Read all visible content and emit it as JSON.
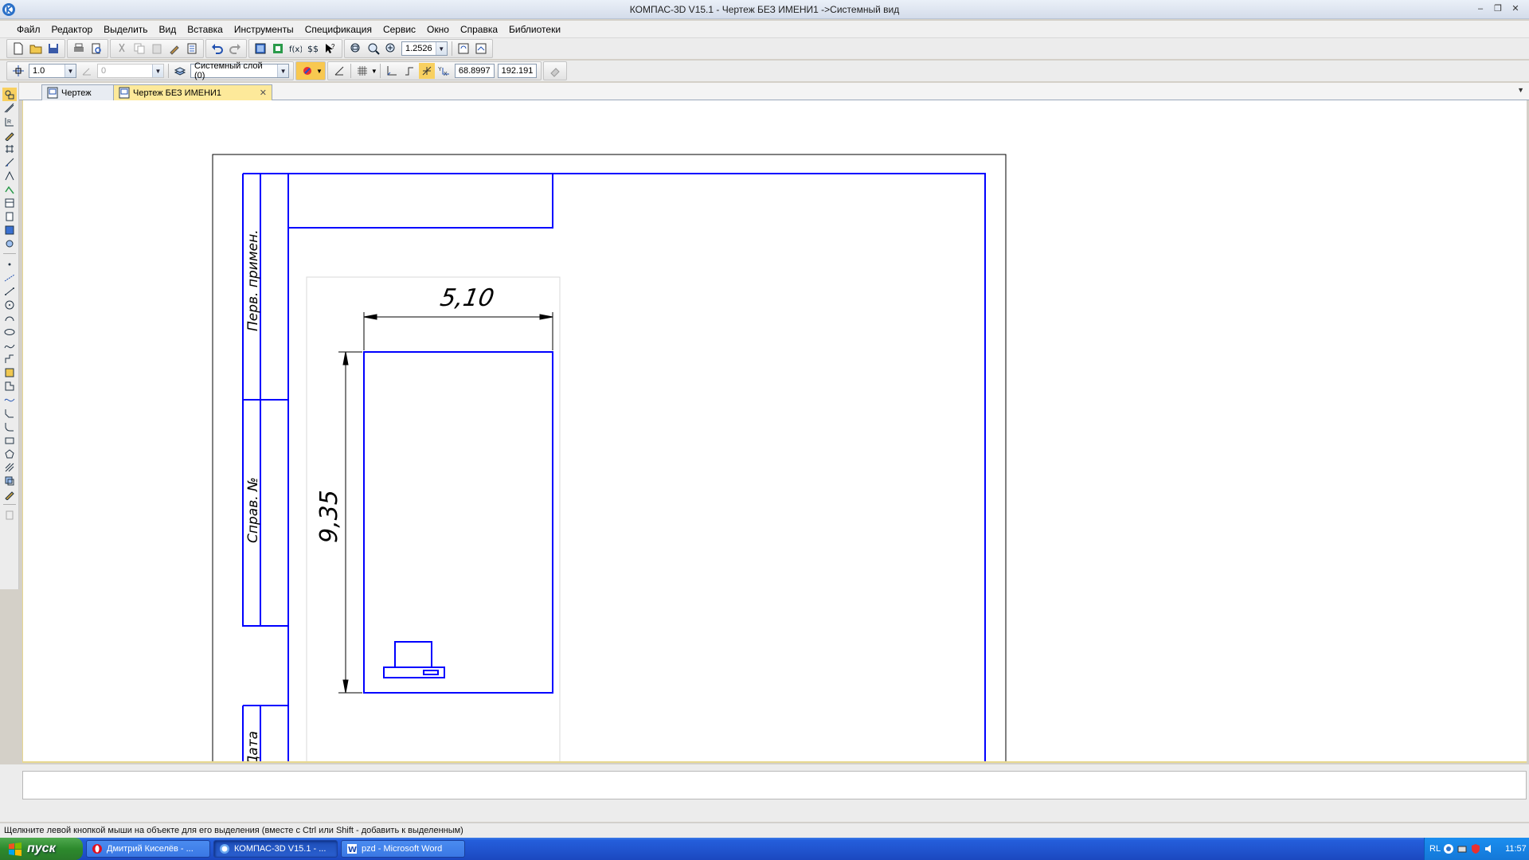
{
  "window": {
    "title": "КОМПАС-3D V15.1 - Чертеж БЕЗ ИМЕНИ1 ->Системный вид",
    "minimize": "‒",
    "restore": "❐",
    "close": "✕"
  },
  "menu": [
    "Файл",
    "Редактор",
    "Выделить",
    "Вид",
    "Вставка",
    "Инструменты",
    "Спецификация",
    "Сервис",
    "Окно",
    "Справка",
    "Библиотеки"
  ],
  "toolbar1": {
    "zoom_value": "1.2526"
  },
  "toolbar2": {
    "step_value": "1.0",
    "angle_value": "0",
    "layer_value": "Системный слой (0)",
    "coord_x": "68.8997",
    "coord_y": "192.191"
  },
  "tabs": [
    {
      "label": "Чертеж",
      "active": false
    },
    {
      "label": "Чертеж БЕЗ ИМЕНИ1",
      "active": true,
      "close": "✕"
    }
  ],
  "drawing": {
    "dim_horizontal": "5,10",
    "dim_vertical": "9,35",
    "stamp_labels": [
      "Перв. примен.",
      "Справ. №",
      "Дата"
    ],
    "line_color": "#0000ff"
  },
  "status_text": "Щелкните левой кнопкой мыши на объекте для его выделения (вместе с Ctrl или Shift - добавить к выделенным)",
  "taskbar": {
    "start_label": "пуск",
    "buttons": [
      {
        "label": "Дмитрий Киселёв - ...",
        "icon": "opera-icon",
        "active": false
      },
      {
        "label": "КОМПАС-3D V15.1 - ...",
        "icon": "kompas-icon",
        "active": true
      },
      {
        "label": "pzd - Microsoft Word",
        "icon": "word-icon",
        "active": false
      }
    ],
    "lang": "RL",
    "clock": "11:57"
  },
  "colors": {
    "accent_tab": "#fde99a",
    "taskbar": "#245edb",
    "start": "#3a963a"
  }
}
